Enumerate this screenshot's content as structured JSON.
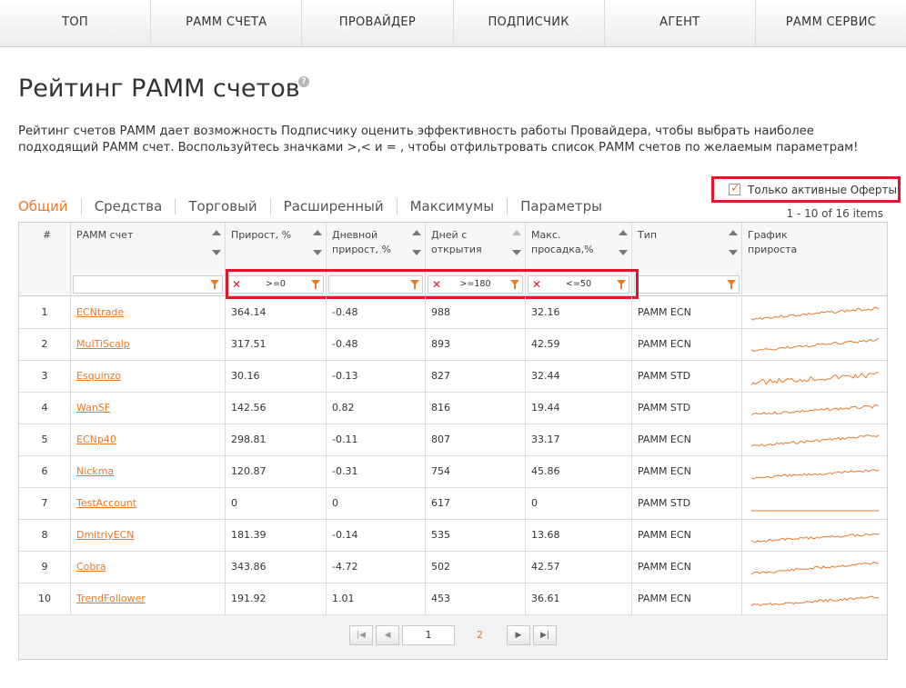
{
  "nav": [
    "ТОП",
    "РАММ СЧЕТА",
    "ПРОВАЙДЕР",
    "ПОДПИСЧИК",
    "АГЕНТ",
    "РАММ СЕРВИС"
  ],
  "page": {
    "title": "Рейтинг РАММ счетов",
    "description": "Рейтинг счетов РАММ дает возможность Подписчику оценить эффективность работы Провайдера, чтобы выбрать наиболее подходящий РАММ счет. Воспользуйтесь значками >,< и = , чтобы отфильтровать список РАММ счетов по желаемым параметрам!"
  },
  "tabs": [
    "Общий",
    "Средства",
    "Торговый",
    "Расширенный",
    "Максимумы",
    "Параметры"
  ],
  "checkbox": {
    "label": "Только активные Оферты",
    "checked": true
  },
  "items_count": "1 - 10 of 16 items",
  "columns": [
    "#",
    "РАММ счет",
    "Прирост, %",
    "Дневной прирост, %",
    "Дней с открытия",
    "Макс. просадка,%",
    "Тип",
    "График прироста"
  ],
  "filters": [
    "",
    ">=0",
    "",
    ">=180",
    "<=50",
    ""
  ],
  "rows": [
    [
      "1",
      "ECNtrade",
      "364.14",
      "-0.48",
      "988",
      "32.16",
      "PAMM ECN"
    ],
    [
      "2",
      "MulTiScalp",
      "317.51",
      "-0.48",
      "893",
      "42.59",
      "PAMM ECN"
    ],
    [
      "3",
      "Esquinzo",
      "30.16",
      "-0.13",
      "827",
      "32.44",
      "PAMM STD"
    ],
    [
      "4",
      "WanSF",
      "142.56",
      "0.82",
      "816",
      "19.44",
      "PAMM STD"
    ],
    [
      "5",
      "ECNp40",
      "298.81",
      "-0.11",
      "807",
      "33.17",
      "PAMM ECN"
    ],
    [
      "6",
      "Nickma",
      "120.87",
      "-0.31",
      "754",
      "45.86",
      "PAMM ECN"
    ],
    [
      "7",
      "TestAccount",
      "0",
      "0",
      "617",
      "0",
      "PAMM STD"
    ],
    [
      "8",
      "DmitriyECN",
      "181.39",
      "-0.14",
      "535",
      "13.68",
      "PAMM ECN"
    ],
    [
      "9",
      "Cobra",
      "343.86",
      "-4.72",
      "502",
      "42.57",
      "PAMM ECN"
    ],
    [
      "10",
      "TrendFollower",
      "191.92",
      "1.01",
      "453",
      "36.61",
      "PAMM ECN"
    ]
  ],
  "pager": {
    "current": "1",
    "next_page": "2"
  },
  "colors": {
    "accent": "#e8792b",
    "highlight": "#e0162b"
  }
}
